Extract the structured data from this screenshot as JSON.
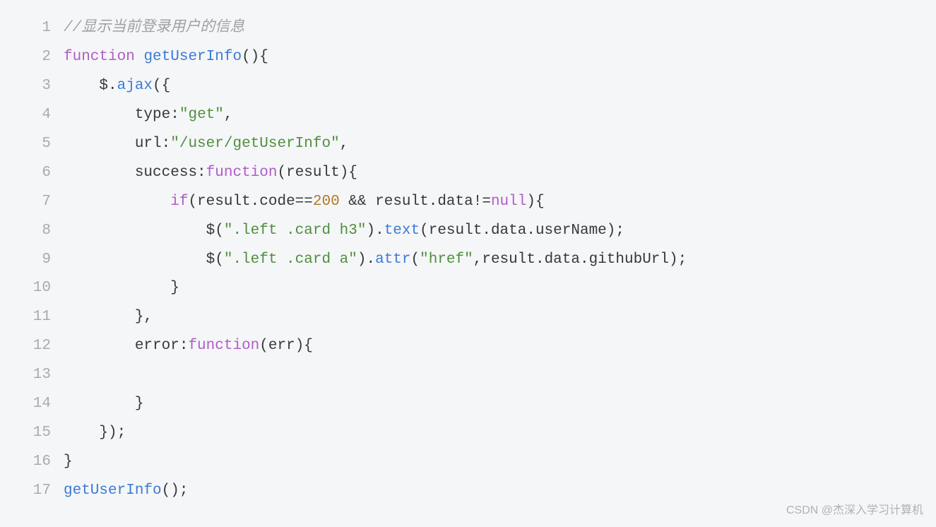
{
  "lineNumbers": [
    "1",
    "2",
    "3",
    "4",
    "5",
    "6",
    "7",
    "8",
    "9",
    "10",
    "11",
    "12",
    "13",
    "14",
    "15",
    "16",
    "17"
  ],
  "code": {
    "l1_comment": "//显示当前登录用户的信息",
    "l2_function": "function",
    "l2_name": "getUserInfo",
    "l2_parens": "(){",
    "l3_indent": "    $.",
    "l3_ajax": "ajax",
    "l3_open": "({",
    "l4_indent": "        ",
    "l4_type": "type",
    "l4_colon": ":",
    "l4_val": "\"get\"",
    "l4_comma": ",",
    "l5_indent": "        ",
    "l5_url": "url",
    "l5_colon": ":",
    "l5_val": "\"/user/getUserInfo\"",
    "l5_comma": ",",
    "l6_indent": "        ",
    "l6_success": "success",
    "l6_colon": ":",
    "l6_func": "function",
    "l6_parens": "(result){",
    "l7_indent": "            ",
    "l7_if": "if",
    "l7_open": "(result.code==",
    "l7_num": "200",
    "l7_and": " && result.data!=",
    "l7_null": "null",
    "l7_close": "){",
    "l8_indent": "                $(",
    "l8_sel": "\".left .card h3\"",
    "l8_dot": ").",
    "l8_text": "text",
    "l8_rest": "(result.data.userName);",
    "l9_indent": "                $(",
    "l9_sel": "\".left .card a\"",
    "l9_dot": ").",
    "l9_attr": "attr",
    "l9_open": "(",
    "l9_href": "\"href\"",
    "l9_rest": ",result.data.githubUrl);",
    "l10": "            }",
    "l11": "        },",
    "l12_indent": "        ",
    "l12_error": "error",
    "l12_colon": ":",
    "l12_func": "function",
    "l12_parens": "(err){",
    "l13": "",
    "l14": "        }",
    "l15": "    });",
    "l16": "}",
    "l17_name": "getUserInfo",
    "l17_call": "();"
  },
  "watermark": "CSDN @杰深入学习计算机"
}
